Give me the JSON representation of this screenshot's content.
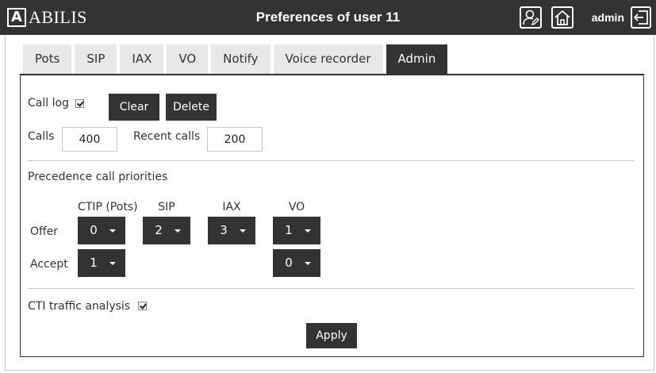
{
  "header": {
    "logo_letter": "A",
    "logo_text": "ABILIS",
    "title": "Preferences of user 11",
    "user": "admin",
    "icons": [
      "user-edit-icon",
      "home-icon",
      "logout-icon"
    ]
  },
  "tabs": [
    {
      "label": "Pots",
      "active": false
    },
    {
      "label": "SIP",
      "active": false
    },
    {
      "label": "IAX",
      "active": false
    },
    {
      "label": "VO",
      "active": false
    },
    {
      "label": "Notify",
      "active": false
    },
    {
      "label": "Voice recorder",
      "active": false
    },
    {
      "label": "Admin",
      "active": true
    }
  ],
  "admin": {
    "call_log": {
      "label": "Call log",
      "checked": true
    },
    "clear_label": "Clear",
    "delete_label": "Delete",
    "calls": {
      "label": "Calls",
      "value": "400"
    },
    "recent_calls": {
      "label": "Recent calls",
      "value": "200"
    },
    "precedence": {
      "title": "Precedence call priorities",
      "columns": [
        "CTIP (Pots)",
        "SIP",
        "IAX",
        "VO"
      ],
      "offer": {
        "label": "Offer",
        "values": [
          "0",
          "2",
          "3",
          "1"
        ]
      },
      "accept": {
        "label": "Accept",
        "ctip": "1",
        "vo": "0"
      }
    },
    "cti": {
      "label": "CTI traffic analysis",
      "checked": true
    },
    "apply_label": "Apply"
  },
  "colors": {
    "dark": "#333333",
    "tab_inactive": "#e8e8e8",
    "border": "#c8c8c8"
  }
}
